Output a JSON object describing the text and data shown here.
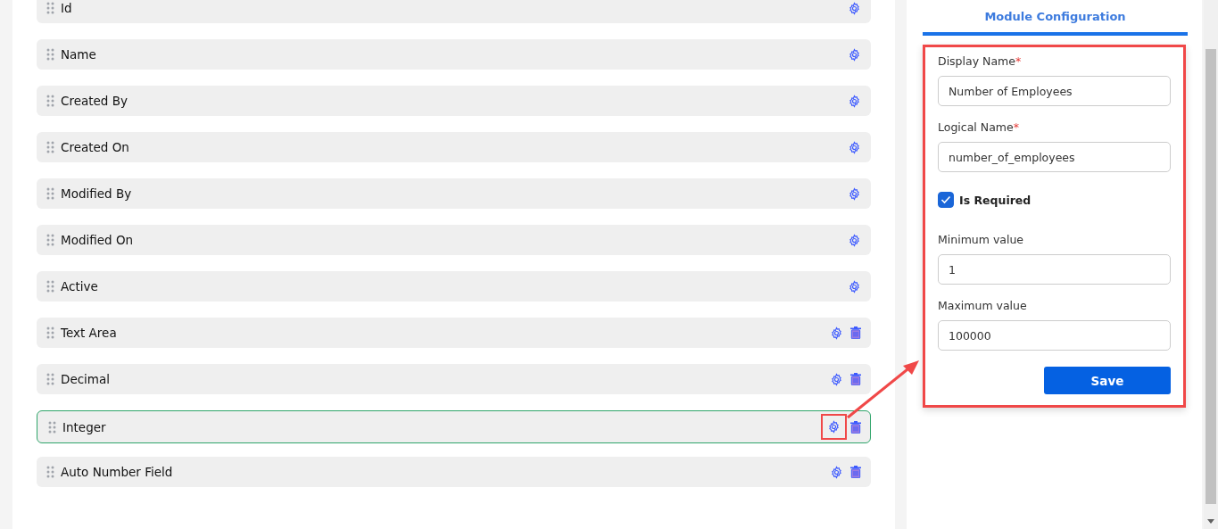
{
  "fields": [
    {
      "label": "Id",
      "deletable": false,
      "selected": false,
      "callout": false
    },
    {
      "label": "Name",
      "deletable": false,
      "selected": false,
      "callout": false
    },
    {
      "label": "Created By",
      "deletable": false,
      "selected": false,
      "callout": false
    },
    {
      "label": "Created On",
      "deletable": false,
      "selected": false,
      "callout": false
    },
    {
      "label": "Modified By",
      "deletable": false,
      "selected": false,
      "callout": false
    },
    {
      "label": "Modified On",
      "deletable": false,
      "selected": false,
      "callout": false
    },
    {
      "label": "Active",
      "deletable": false,
      "selected": false,
      "callout": false
    },
    {
      "label": "Text Area",
      "deletable": true,
      "selected": false,
      "callout": false
    },
    {
      "label": "Decimal",
      "deletable": true,
      "selected": false,
      "callout": false
    },
    {
      "label": "Integer",
      "deletable": true,
      "selected": true,
      "callout": true
    },
    {
      "label": "Auto Number Field",
      "deletable": true,
      "selected": false,
      "callout": false
    }
  ],
  "config": {
    "tab": {
      "label": "Module Configuration",
      "selected": true
    },
    "highlighted": true,
    "inputs": [
      {
        "label": "Display Name",
        "required_mark": "*",
        "value": "Number of Employees"
      },
      {
        "label": "Logical Name",
        "required_mark": "*",
        "value": "number_of_employees"
      }
    ],
    "required_checkbox": {
      "label": "Is Required",
      "checked": true
    },
    "range_inputs": [
      {
        "label": "Minimum value",
        "value": "1"
      },
      {
        "label": "Maximum value",
        "value": "100000"
      }
    ],
    "save_button": "Save"
  }
}
